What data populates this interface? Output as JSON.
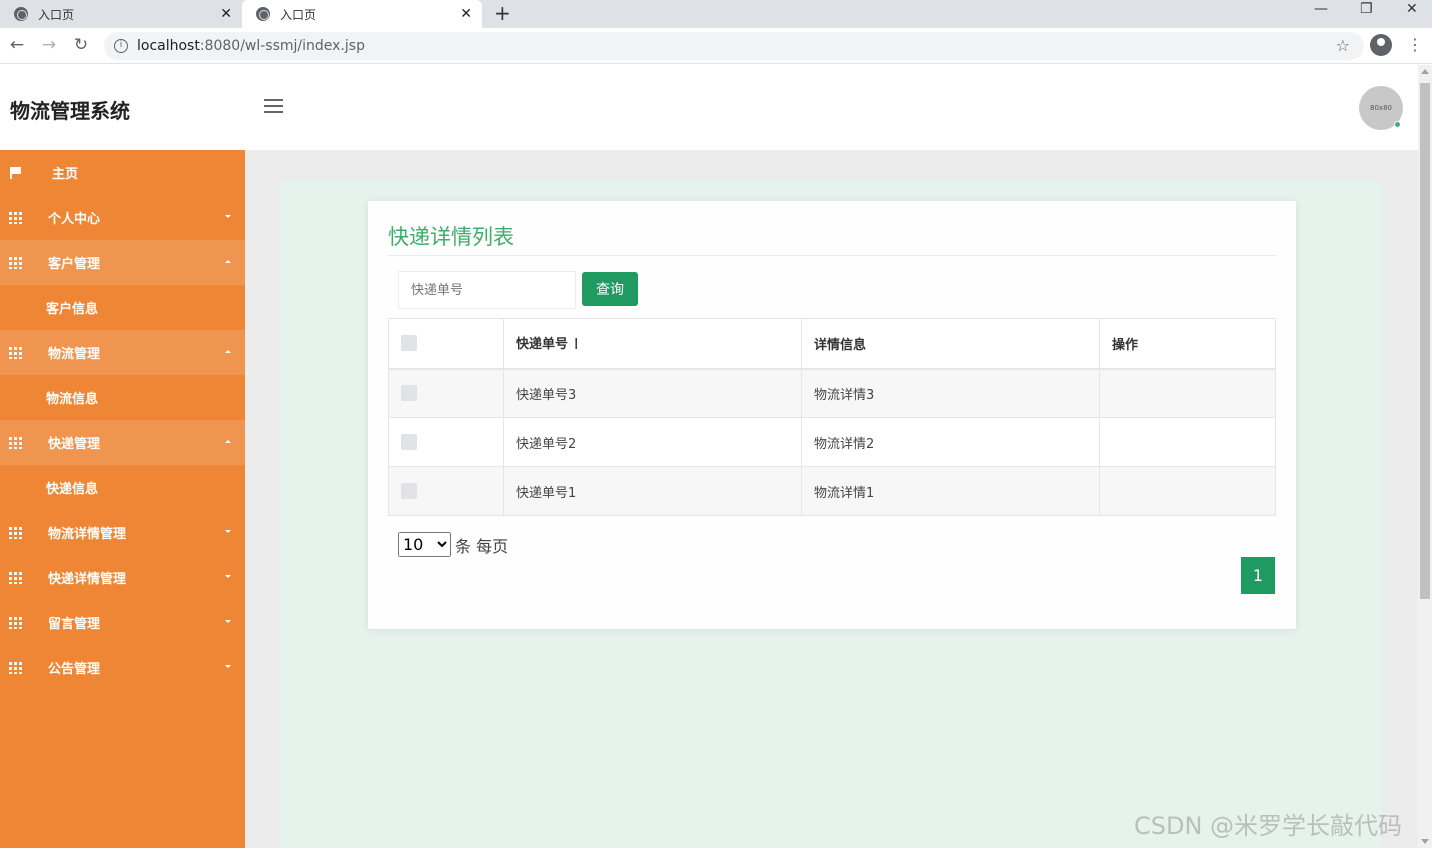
{
  "browser": {
    "tabs": [
      {
        "title": "入口页",
        "close": "✕"
      },
      {
        "title": "入口页",
        "close": "✕"
      }
    ],
    "new_tab": "+",
    "window_controls": [
      "—",
      "❐",
      "✕"
    ],
    "url_host": "localhost",
    "url_rest": ":8080/wl-ssmj/index.jsp"
  },
  "header": {
    "brand": "物流管理系统",
    "avatar_text": "80x80"
  },
  "sidebar": {
    "items": [
      {
        "label": "主页",
        "icon": "flag-icon",
        "state": "none"
      },
      {
        "label": "个人中心",
        "icon": "grid-icon",
        "state": "collapsed"
      },
      {
        "label": "客户管理",
        "icon": "grid-icon",
        "state": "expanded"
      },
      {
        "label": "客户信息",
        "icon": "",
        "state": "sub"
      },
      {
        "label": "物流管理",
        "icon": "grid-icon",
        "state": "expanded"
      },
      {
        "label": "物流信息",
        "icon": "",
        "state": "sub"
      },
      {
        "label": "快递管理",
        "icon": "grid-icon",
        "state": "expanded"
      },
      {
        "label": "快递信息",
        "icon": "",
        "state": "sub"
      },
      {
        "label": "物流详情管理",
        "icon": "grid-icon",
        "state": "collapsed"
      },
      {
        "label": "快递详情管理",
        "icon": "grid-icon",
        "state": "collapsed"
      },
      {
        "label": "留言管理",
        "icon": "grid-icon",
        "state": "collapsed"
      },
      {
        "label": "公告管理",
        "icon": "grid-icon",
        "state": "collapsed"
      }
    ]
  },
  "main": {
    "title": "快递详情列表",
    "search": {
      "placeholder": "快递单号",
      "value": "",
      "button": "查询"
    },
    "table": {
      "headers": [
        "快递单号",
        "详情信息",
        "操作"
      ],
      "rows": [
        {
          "no": "快递单号3",
          "detail": "物流详情3",
          "action": ""
        },
        {
          "no": "快递单号2",
          "detail": "物流详情2",
          "action": ""
        },
        {
          "no": "快递单号1",
          "detail": "物流详情1",
          "action": ""
        }
      ]
    },
    "pager": {
      "page_size": "10",
      "page_size_suffix": "条 每页",
      "current_page": "1"
    }
  },
  "watermark": "CSDN @米罗学长敲代码",
  "colors": {
    "sidebar": "#ee8635",
    "sidebar_open": "#f0954f",
    "accent_green": "#1f9a61",
    "title_green": "#3dae6c",
    "content_bg": "#e5f3ec"
  }
}
